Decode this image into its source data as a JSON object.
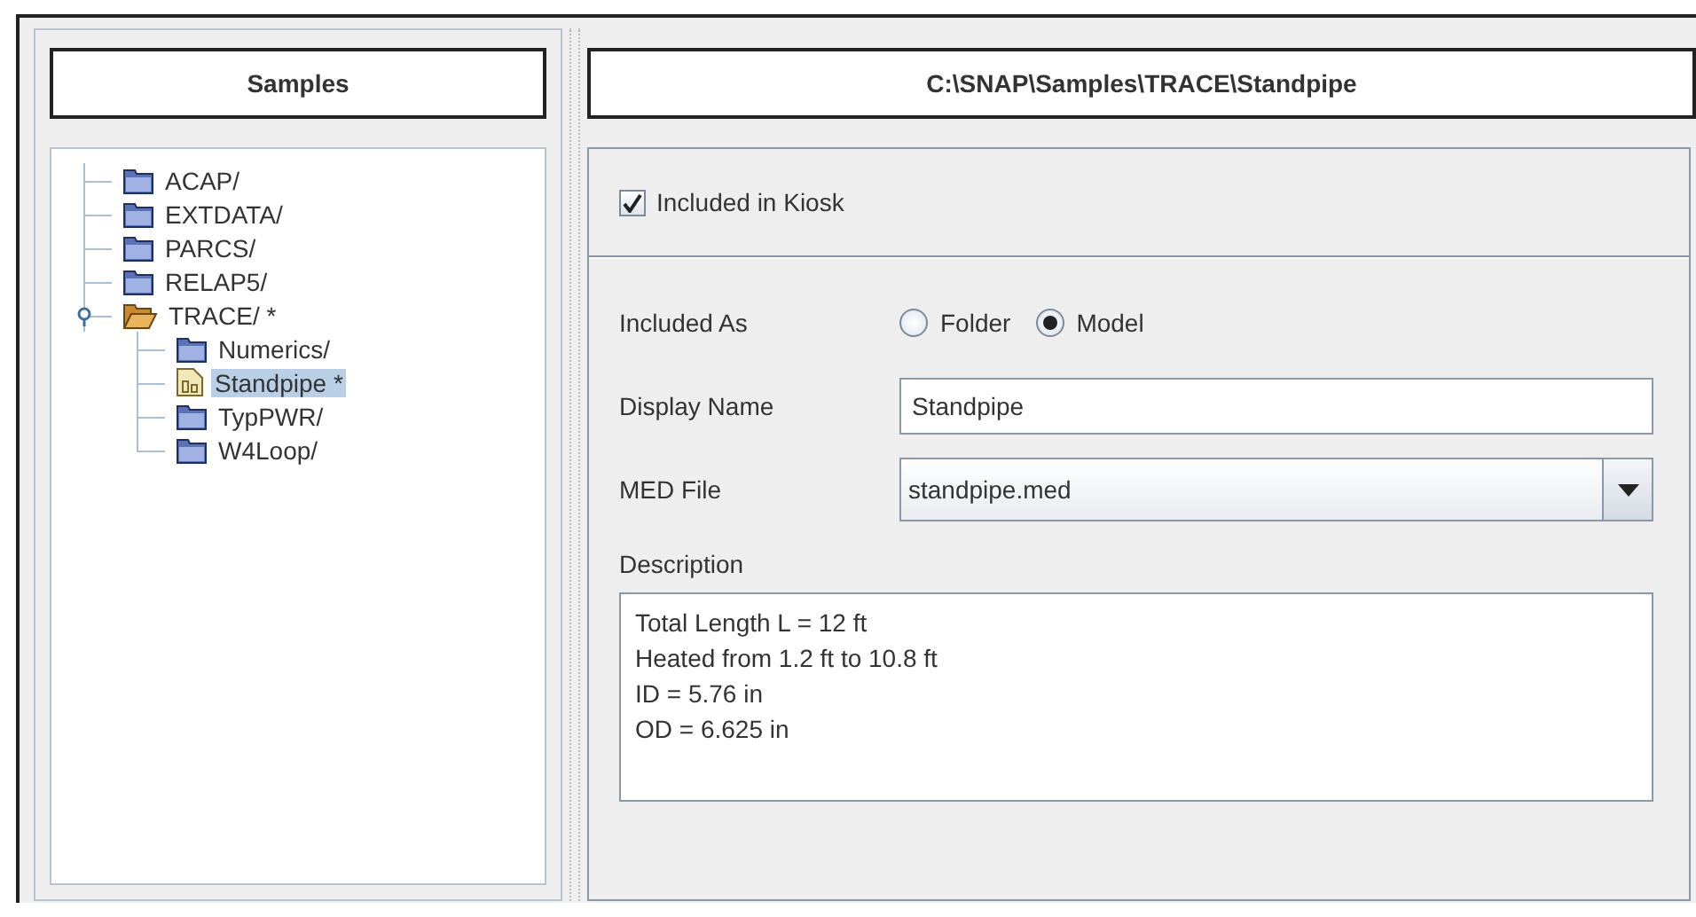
{
  "left_panel": {
    "title": "Samples",
    "tree": [
      {
        "label": "ACAP/",
        "kind": "folder",
        "selected": false
      },
      {
        "label": "EXTDATA/",
        "kind": "folder",
        "selected": false
      },
      {
        "label": "PARCS/",
        "kind": "folder",
        "selected": false
      },
      {
        "label": "RELAP5/",
        "kind": "folder",
        "selected": false
      },
      {
        "label": "TRACE/ *",
        "kind": "folder",
        "selected": false,
        "expanded": true,
        "children": [
          {
            "label": "Numerics/",
            "kind": "folder",
            "selected": false
          },
          {
            "label": "Standpipe *",
            "kind": "model",
            "selected": true
          },
          {
            "label": "TypPWR/",
            "kind": "folder",
            "selected": false
          },
          {
            "label": "W4Loop/",
            "kind": "folder",
            "selected": false
          }
        ]
      }
    ]
  },
  "right_panel": {
    "title": "C:\\SNAP\\Samples\\TRACE\\Standpipe",
    "included_in_kiosk": {
      "label": "Included in Kiosk",
      "checked": true
    },
    "included_as": {
      "label": "Included As",
      "options": [
        {
          "label": "Folder",
          "selected": false
        },
        {
          "label": "Model",
          "selected": true
        }
      ]
    },
    "display_name": {
      "label": "Display Name",
      "value": "Standpipe"
    },
    "med_file": {
      "label": "MED File",
      "value": "standpipe.med"
    },
    "description": {
      "label": "Description",
      "value": "Total Length L = 12 ft\nHeated from 1.2 ft to 10.8 ft\nID = 5.76 in\nOD = 6.625 in"
    }
  }
}
